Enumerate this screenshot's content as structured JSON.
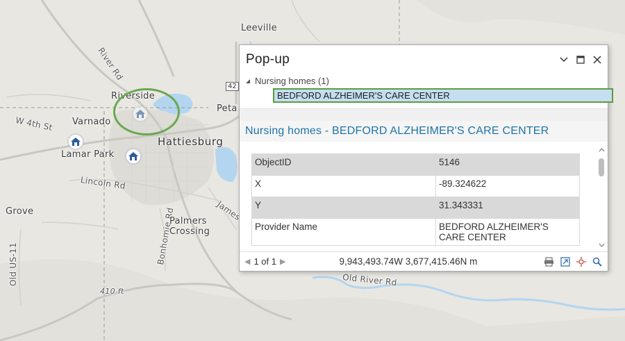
{
  "map": {
    "labels": {
      "leeville": "Leeville",
      "river_rd": "River Rd",
      "riverside": "Riverside",
      "varnado": "Varnado",
      "w4th": "W 4th St",
      "hattiesburg": "Hattiesburg",
      "lamar_park": "Lamar Park",
      "lincoln_rd": "Lincoln Rd",
      "grove": "Grove",
      "old_us11": "Old US-11",
      "bonhomie_rd": "Bonhomie Rd",
      "palmers_crossing": "Palmers\nCrossing",
      "elevation": "410 ft",
      "peta": "Peta",
      "james": "James",
      "old_river_rd": "Old River Rd",
      "shield_42": "42"
    },
    "icons": [
      "nursing-home-icon",
      "nursing-home-icon",
      "nursing-home-icon"
    ],
    "colors": {
      "highlight": "#6aa84f",
      "water": "#b3d5f0",
      "poi_blue": "#2b5c9e"
    }
  },
  "popup": {
    "title": "Pop-up",
    "controls": [
      "chevron-down-icon",
      "maximize-icon",
      "close-icon"
    ],
    "tree": {
      "group_label": "Nursing homes (1)",
      "selected_item": "BEDFORD ALZHEIMER'S CARE CENTER"
    },
    "feature_title": "Nursing homes - BEDFORD ALZHEIMER'S CARE CENTER",
    "attributes": [
      {
        "field": "ObjectID",
        "value": "5146"
      },
      {
        "field": "X",
        "value": "-89.324622"
      },
      {
        "field": "Y",
        "value": "31.343331"
      },
      {
        "field": "Provider Name",
        "value": "BEDFORD ALZHEIMER'S CARE CENTER"
      }
    ],
    "status": {
      "pager": "1 of 1",
      "coordinates": "9,943,493.74W 3,677,415.46N m",
      "tools": [
        "print-icon",
        "export-icon",
        "flash-feature-icon",
        "zoom-to-icon"
      ]
    },
    "colors": {
      "title_blue": "#1e73a8",
      "selection_fill": "#c5def0",
      "selection_border": "#5e9b3f"
    }
  }
}
